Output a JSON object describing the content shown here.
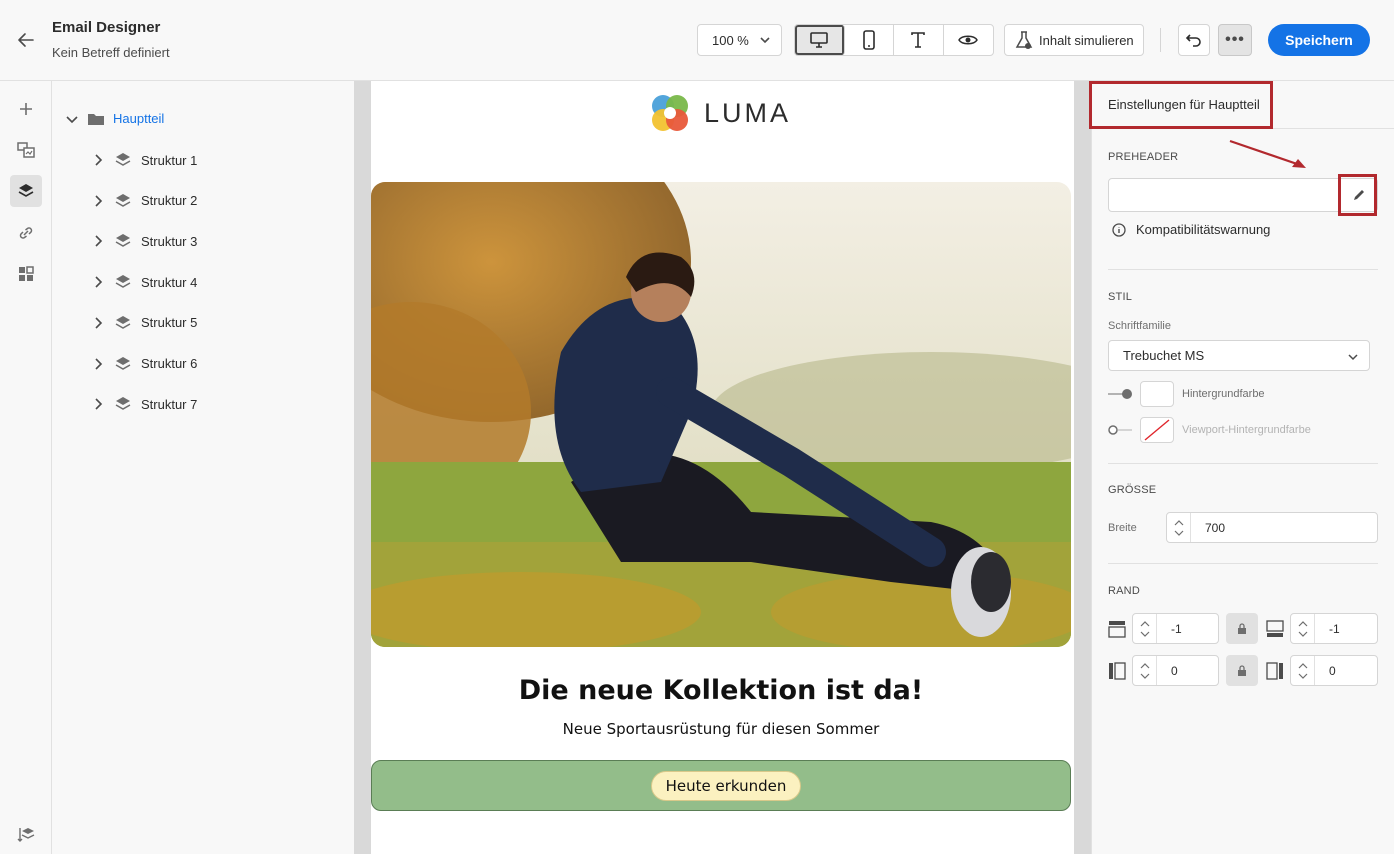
{
  "header": {
    "title": "Email Designer",
    "subtitle": "Kein Betreff definiert",
    "zoom": "100 %",
    "simulate_label": "Inhalt simulieren",
    "save_label": "Speichern",
    "more_label": "•••"
  },
  "tree": {
    "root_label": "Hauptteil",
    "items": [
      "Struktur 1",
      "Struktur 2",
      "Struktur 3",
      "Struktur 4",
      "Struktur 5",
      "Struktur 6",
      "Struktur 7"
    ]
  },
  "email": {
    "logo_text": "LUMA",
    "headline": "Die neue Kollektion ist da!",
    "subline": "Neue Sportausrüstung für diesen Sommer",
    "cta_label": "Heute erkunden"
  },
  "settings": {
    "title": "Einstellungen für Hauptteil",
    "preheader_label": "PREHEADER",
    "preheader_value": "",
    "compat_warning": "Kompatibilitätswarnung",
    "style_label": "STIL",
    "font_family_label": "Schriftfamilie",
    "font_family_value": "Trebuchet MS",
    "bg_color_label": "Hintergrundfarbe",
    "viewport_bg_label": "Viewport-Hintergrundfarbe",
    "size_label": "GRÖSSE",
    "width_label": "Breite",
    "width_value": "700",
    "margin_label": "RAND",
    "margin_top": "-1",
    "margin_bottom": "-1",
    "margin_left": "0",
    "margin_right": "0"
  },
  "colors": {
    "accent": "#1473e6",
    "annotation": "#b2292e",
    "cta_bar": "#93bd8a",
    "cta_button": "#fbf1c0"
  }
}
